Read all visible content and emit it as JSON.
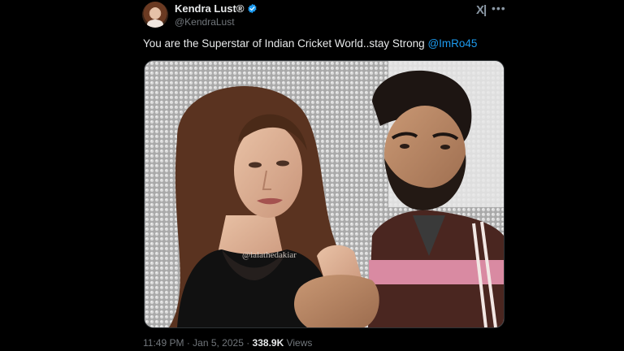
{
  "tweet": {
    "author": {
      "display_name": "Kendra Lust®",
      "handle": "@KendraLust",
      "verified": true,
      "avatar_icon": "profile-avatar"
    },
    "text": "You are the Superstar of Indian Cricket World..stay Strong ",
    "mention": "@ImRo45",
    "media": {
      "watermark": "@lalathedakiar"
    },
    "meta": {
      "time": "11:49 PM",
      "separator": " · ",
      "date": "Jan 5, 2025",
      "views_count": "338.9K",
      "views_label": " Views"
    },
    "header_icons": [
      "x-logo-icon",
      "more-options-icon"
    ]
  },
  "colors": {
    "background": "#000000",
    "text": "#e7e9ea",
    "secondary_text": "#71767b",
    "accent": "#1d9bf0",
    "verified_badge": "#1d9bf0"
  }
}
